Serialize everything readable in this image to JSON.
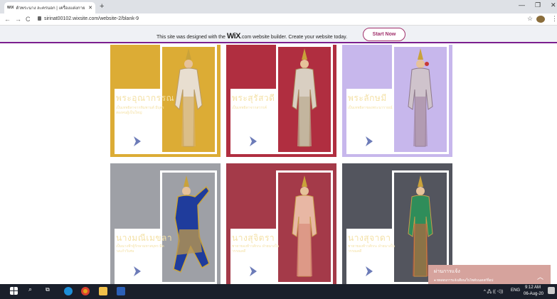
{
  "browser": {
    "tab_title": "ตัวพระนาง ละครนอก | เครื่องแต่งกาย",
    "tab_logo": "WiX",
    "new_tab_label": "+",
    "url": "sirinat00102.wixsite.com/website-2/blank-9",
    "window_controls": [
      "—",
      "❐",
      "✕"
    ],
    "nav": [
      "←",
      "→",
      "C"
    ]
  },
  "banner": {
    "text_before": "This site was designed with the",
    "brand": "WiX",
    "text_after": ".com website builder. Create your website today.",
    "button": "Start Now"
  },
  "cards": [
    {
      "name": "พระอุณากรรณ",
      "desc": "เป็นเทพธิดาจากหิมพานต์ มีบุตรสองคนผู้เป็นใหญ่",
      "color": "#dcac35"
    },
    {
      "name": "พระสุรัสวดี",
      "desc": "เป็นเทพธิดาจากสวรรค์",
      "color": "#b02e40"
    },
    {
      "name": "พระลักษมี",
      "desc": "เป็นเทพธิดาของพระนารายณ์",
      "color": "#c7b7ec"
    },
    {
      "name": "นางมณีเมขลา",
      "desc": "เป็นนางฟ้าผู้รักษามหาสมุทร มีดวงแก้ววิเศษ",
      "color": "#9ea0a6"
    },
    {
      "name": "นางสุจิตรา",
      "desc": "ชายาของท้าวสักกะ ฝ่ายนางในวรรณคดี",
      "color": "#a43a49"
    },
    {
      "name": "นางสุจาดา",
      "desc": "ชายาของท้าวสักกะ ฝ่ายนางในวรรณคดี",
      "color": "#53555e"
    }
  ],
  "notification": {
    "title": "ผ่านการแจ้ง",
    "desc": "● ทดสอบการแจ้งเตือนเว็บไซต์บนเดสก์ท็อป"
  },
  "taskbar": {
    "lang": "ENG",
    "time": "9:12 AM",
    "date": "06-Aug-20",
    "tray_icons": "^ 🖧 (( ◁))"
  }
}
